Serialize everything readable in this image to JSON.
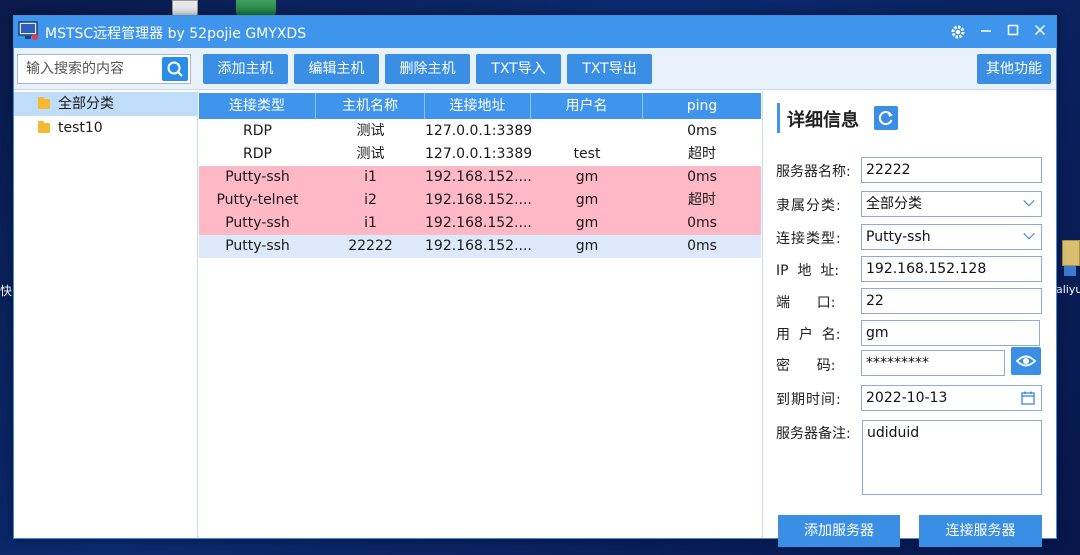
{
  "window": {
    "title": "MSTSC远程管理器  by 52pojie GMYXDS"
  },
  "toolbar": {
    "search_placeholder": "输入搜索的内容",
    "buttons": [
      "添加主机",
      "编辑主机",
      "删除主机",
      "TXT导入",
      "TXT导出"
    ],
    "other_label": "其他功能"
  },
  "tree": {
    "items": [
      {
        "label": "全部分类",
        "selected": true
      },
      {
        "label": "test10",
        "selected": false
      }
    ]
  },
  "grid": {
    "columns": [
      "连接类型",
      "主机名称",
      "连接地址",
      "用户名",
      "ping"
    ],
    "rows": [
      {
        "type": "RDP",
        "name": "测试",
        "address": "127.0.0.1:3389",
        "user": "",
        "ping": "0ms",
        "style": "white"
      },
      {
        "type": "RDP",
        "name": "测试",
        "address": "127.0.0.1:3389",
        "user": "test",
        "ping": "超时",
        "style": "white"
      },
      {
        "type": "Putty-ssh",
        "name": "i1",
        "address": "192.168.152....",
        "user": "gm",
        "ping": "0ms",
        "style": "pink"
      },
      {
        "type": "Putty-telnet",
        "name": "i2",
        "address": "192.168.152....",
        "user": "gm",
        "ping": "超时",
        "style": "pink"
      },
      {
        "type": "Putty-ssh",
        "name": "i1",
        "address": "192.168.152....",
        "user": "gm",
        "ping": "0ms",
        "style": "pink"
      },
      {
        "type": "Putty-ssh",
        "name": "22222",
        "address": "192.168.152....",
        "user": "gm",
        "ping": "0ms",
        "style": "selected"
      }
    ]
  },
  "detail": {
    "title": "详细信息",
    "fields": {
      "server_name_label": "服务器名称:",
      "server_name": "22222",
      "category_label": "隶属分类:",
      "category": "全部分类",
      "conn_type_label": "连接类型:",
      "conn_type": "Putty-ssh",
      "ip_label": "IP  地  址:",
      "ip": "192.168.152.128",
      "port_label": "端      口:",
      "port": "22",
      "user_label": "用  户  名:",
      "user": "gm",
      "password_label": "密      码:",
      "password": "*********",
      "expire_label": "到期时间:",
      "expire": "2022-10-13",
      "note_label": "服务器备注:",
      "note": "udiduid"
    },
    "add_button": "添加服务器",
    "connect_button": "连接服务器"
  },
  "desktop": {
    "left_text": "快",
    "right_text": "aliyun - 快捷"
  },
  "colors": {
    "accent": "#3f95ec",
    "button": "#3a8fe4",
    "row_pink": "#ffb8c6",
    "row_selected": "#dbe9fa"
  }
}
